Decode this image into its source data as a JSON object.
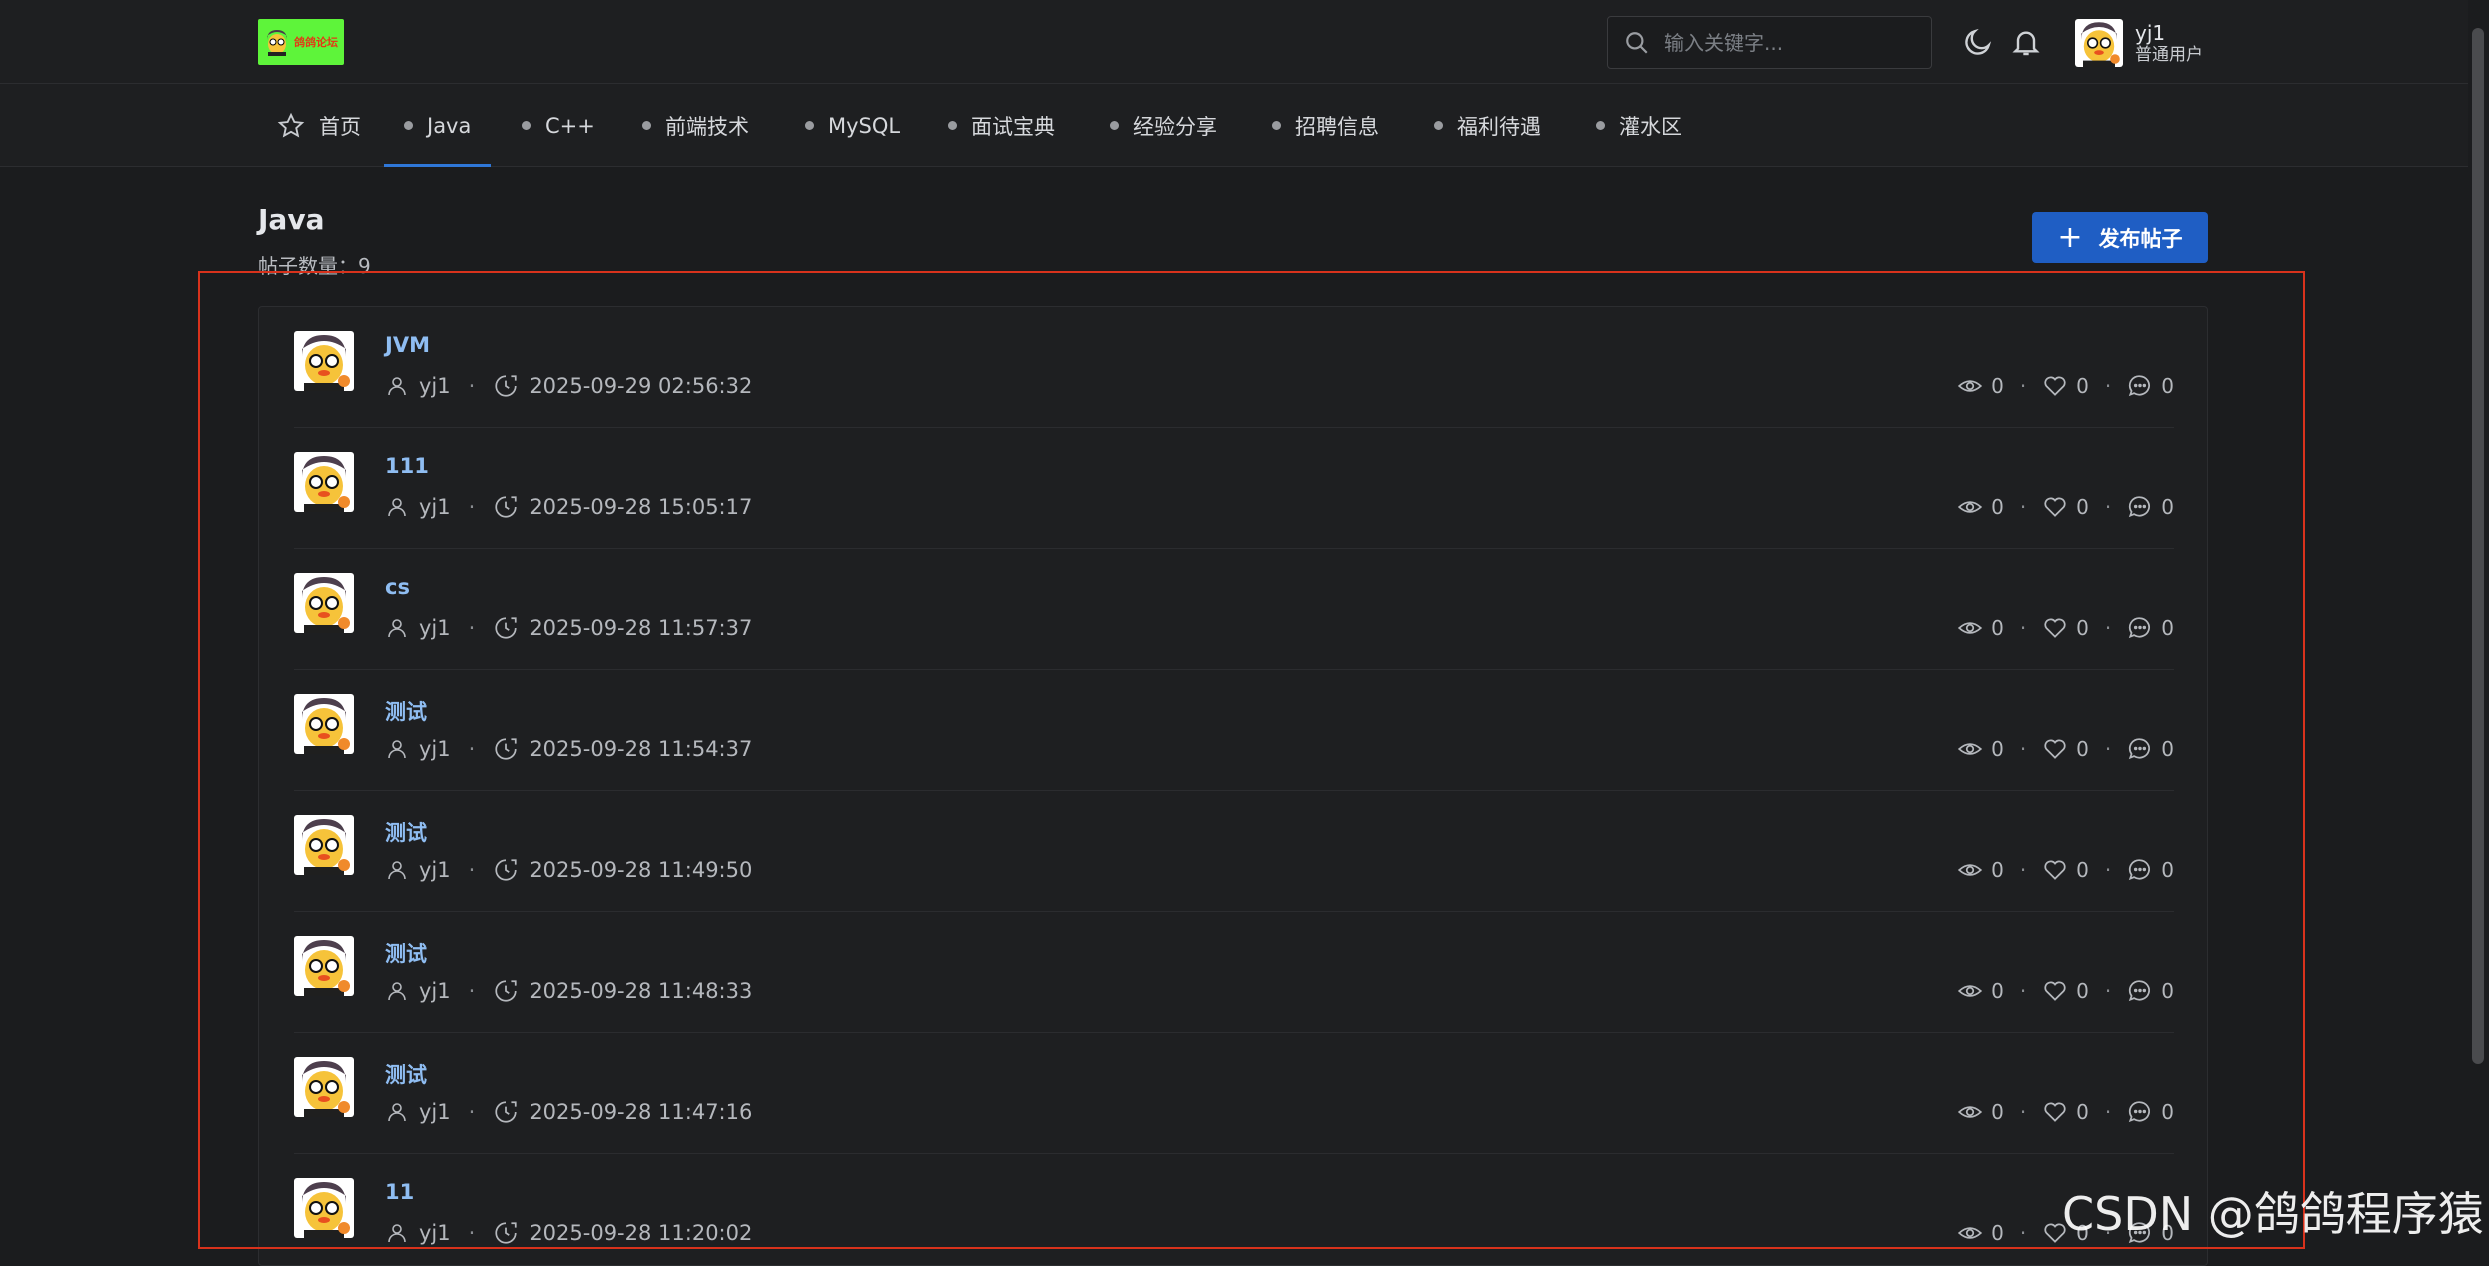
{
  "header": {
    "logo_text": "鸽鸽论坛",
    "search_placeholder": "输入关键字...",
    "user": {
      "name": "yj1",
      "role": "普通用户"
    }
  },
  "nav": {
    "items": [
      {
        "label": "首页",
        "icon": "star-icon"
      },
      {
        "label": "Java",
        "active": true
      },
      {
        "label": "C++"
      },
      {
        "label": "前端技术"
      },
      {
        "label": "MySQL"
      },
      {
        "label": "面试宝典"
      },
      {
        "label": "经验分享"
      },
      {
        "label": "招聘信息"
      },
      {
        "label": "福利待遇"
      },
      {
        "label": "灌水区"
      }
    ]
  },
  "board": {
    "title": "Java",
    "post_count": "帖子数量：9",
    "publish_label": "发布帖子"
  },
  "posts": [
    {
      "title": "JVM",
      "author": "yj1",
      "time": "2025-09-29 02:56:32",
      "views": "0",
      "likes": "0",
      "comments": "0"
    },
    {
      "title": "111",
      "author": "yj1",
      "time": "2025-09-28 15:05:17",
      "views": "0",
      "likes": "0",
      "comments": "0"
    },
    {
      "title": "cs",
      "author": "yj1",
      "time": "2025-09-28 11:57:37",
      "views": "0",
      "likes": "0",
      "comments": "0"
    },
    {
      "title": "测试",
      "author": "yj1",
      "time": "2025-09-28 11:54:37",
      "views": "0",
      "likes": "0",
      "comments": "0"
    },
    {
      "title": "测试",
      "author": "yj1",
      "time": "2025-09-28 11:49:50",
      "views": "0",
      "likes": "0",
      "comments": "0"
    },
    {
      "title": "测试",
      "author": "yj1",
      "time": "2025-09-28 11:48:33",
      "views": "0",
      "likes": "0",
      "comments": "0"
    },
    {
      "title": "测试",
      "author": "yj1",
      "time": "2025-09-28 11:47:16",
      "views": "0",
      "likes": "0",
      "comments": "0"
    },
    {
      "title": "11",
      "author": "yj1",
      "time": "2025-09-28 11:20:02",
      "views": "0",
      "likes": "0",
      "comments": "0"
    }
  ],
  "colors": {
    "background": "#1b1c1e",
    "accent": "#1f5ec4",
    "link": "#8fbdf2",
    "highlight_border": "#d8321c",
    "logo_bg": "#5ef43a"
  },
  "watermark": "CSDN @鸽鸽程序猿"
}
